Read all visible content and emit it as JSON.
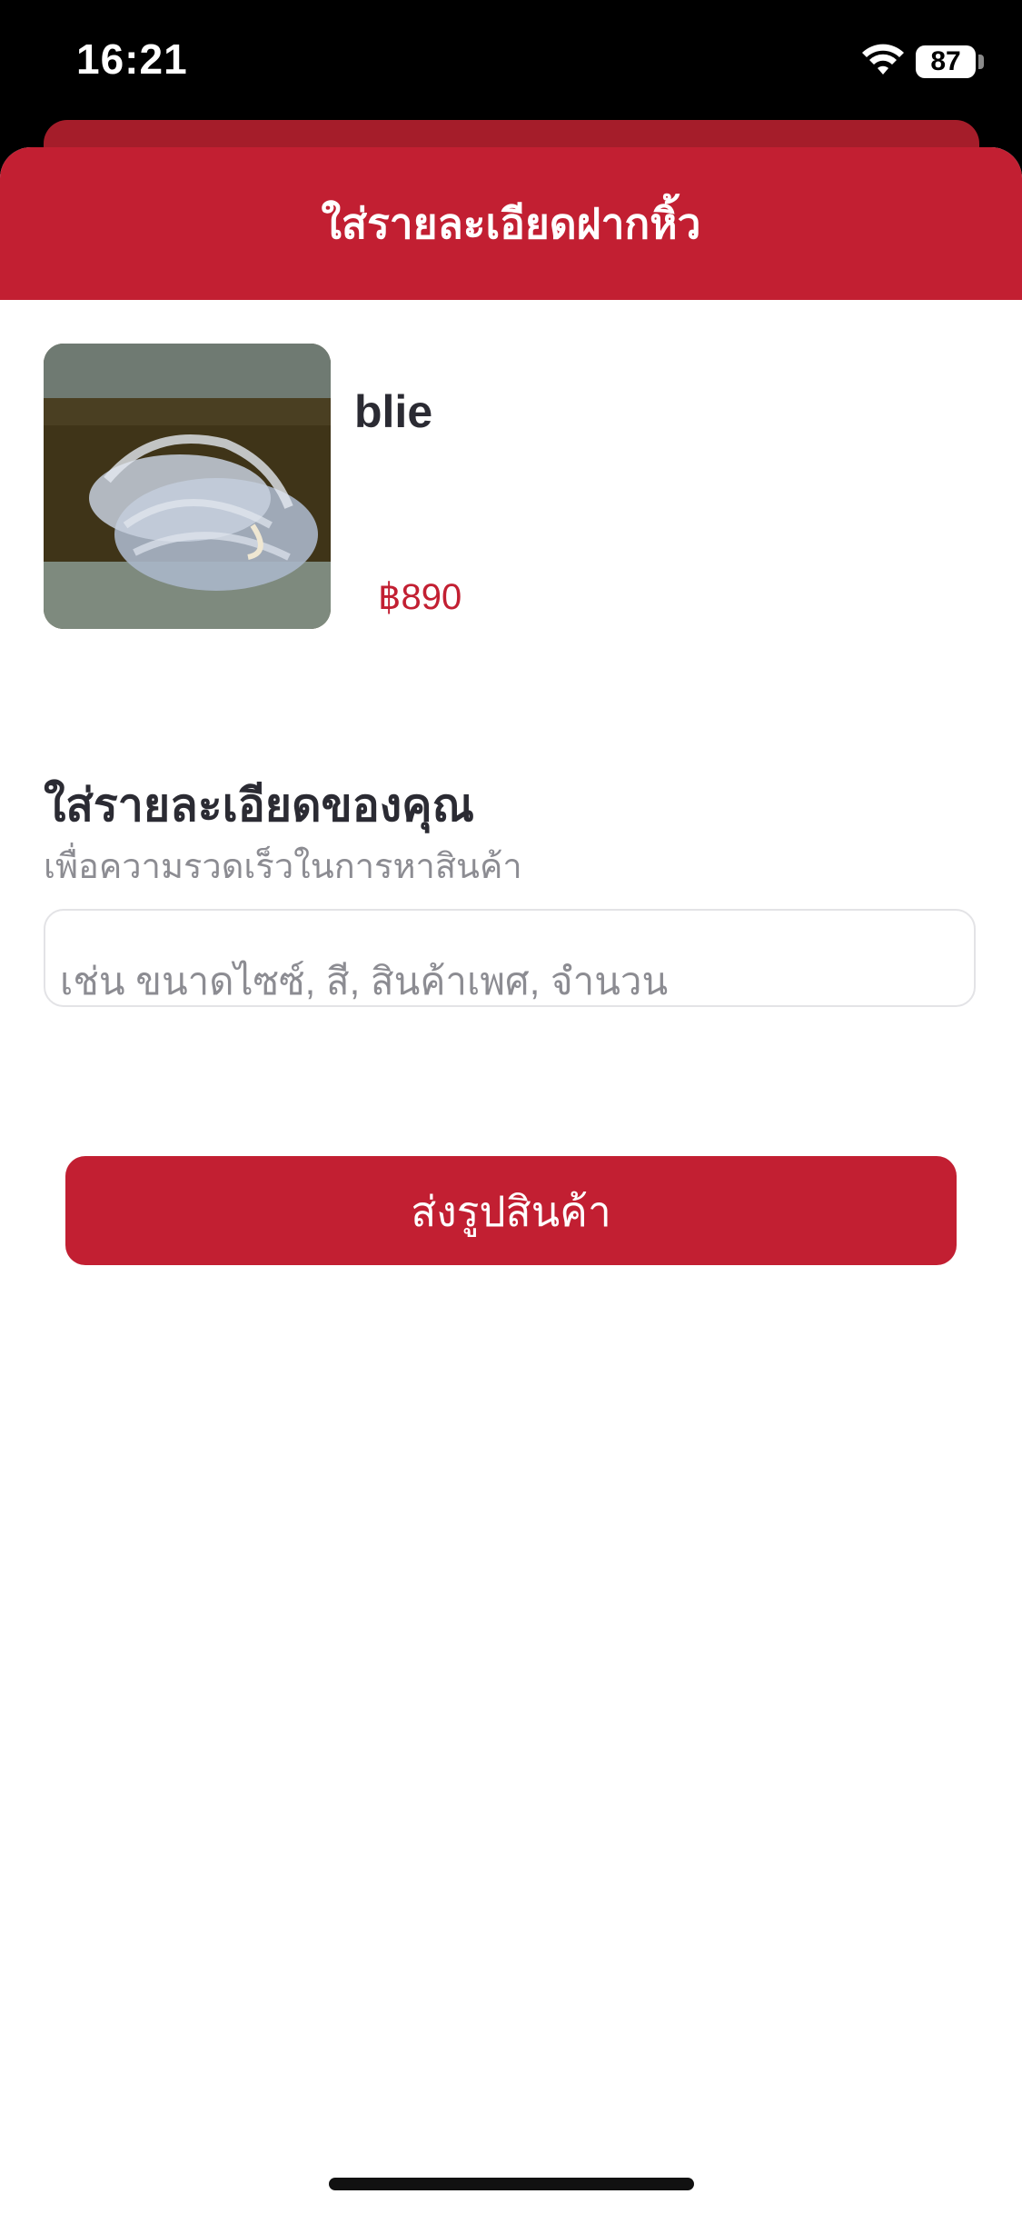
{
  "status_bar": {
    "time": "16:21",
    "battery": "87",
    "icons": [
      "wifi-icon",
      "battery-icon"
    ]
  },
  "header": {
    "title": "ใส่รายละเอียดฝากหิ้ว"
  },
  "product": {
    "name": "blie",
    "price": "฿890",
    "image_alt": "clear jelly sandals"
  },
  "details": {
    "title": "ใส่รายละเอียดของคุณ",
    "subtitle": "เพื่อความรวดเร็วในการหาสินค้า",
    "input_value": "",
    "input_placeholder": "เช่น ขนาดไซซ์, สี, สินค้าเพศ, จำนวน"
  },
  "actions": {
    "send_label": "ส่งรูปสินค้า"
  },
  "colors": {
    "brand": "#c21f32",
    "back_sheet": "#a51d2a",
    "text_dark": "#2b2b33",
    "text_muted": "#8c8c92"
  }
}
